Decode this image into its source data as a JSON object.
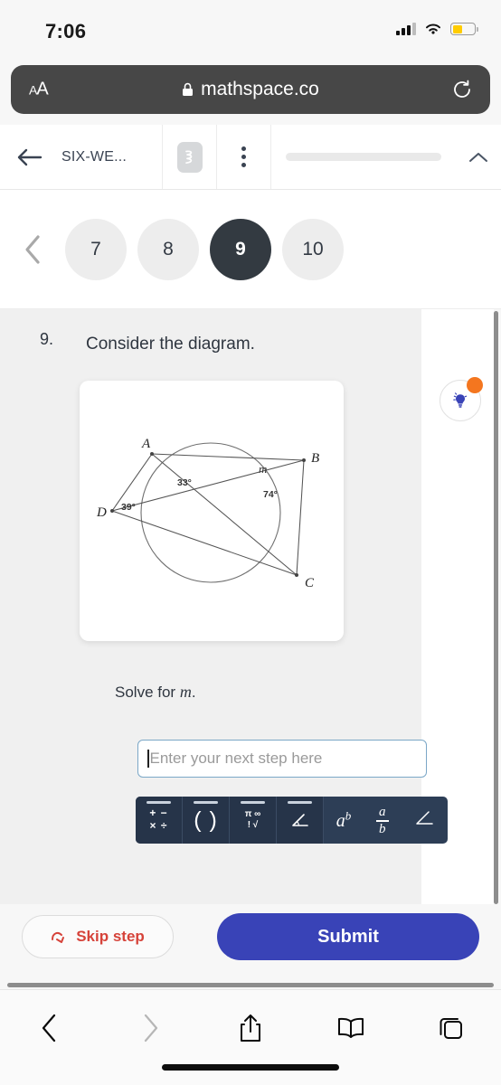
{
  "status_bar": {
    "time": "7:06",
    "signal_icon": "signal-bars-icon",
    "wifi_icon": "wifi-icon",
    "battery_icon": "battery-icon",
    "battery_color": "#ffcc00"
  },
  "browser": {
    "text_size_label": "AA",
    "lock_icon": "lock-icon",
    "url": "mathspace.co",
    "reload_icon": "reload-icon",
    "bottom_toolbar": {
      "back_icon": "chevron-left-icon",
      "forward_icon": "chevron-right-icon",
      "share_icon": "share-icon",
      "bookmarks_icon": "book-icon",
      "tabs_icon": "tabs-icon"
    }
  },
  "app_nav": {
    "back_icon": "arrow-left-icon",
    "title": "SIX-WE...",
    "logo_icon": "mathspace-logo-icon",
    "menu_icon": "more-vertical-icon",
    "collapse_icon": "chevron-up-icon"
  },
  "question_pills": {
    "prev_icon": "chevron-left-icon",
    "items": [
      {
        "label": "7",
        "active": false
      },
      {
        "label": "8",
        "active": false
      },
      {
        "label": "9",
        "active": true
      },
      {
        "label": "10",
        "active": false
      }
    ]
  },
  "question": {
    "number": "9.",
    "prompt": "Consider the diagram.",
    "instruction_prefix": "Solve for ",
    "instruction_variable": "m",
    "instruction_suffix": "."
  },
  "diagram": {
    "type": "circle-with-inscribed-quadrilateral",
    "vertex_labels": [
      "A",
      "B",
      "C",
      "D"
    ],
    "angle_labels": [
      {
        "text": "33°",
        "at_vertex": "A"
      },
      {
        "text": "39°",
        "at_vertex": "D"
      },
      {
        "text": "m",
        "at_vertex": "B"
      },
      {
        "text": "74°",
        "at_vertex": "B"
      }
    ]
  },
  "answer_input": {
    "placeholder": "Enter your next step here",
    "value": "",
    "border_color": "#7ba7c7"
  },
  "math_keyboard": {
    "tabs": [
      {
        "name": "operators-tab",
        "icon": "plus-minus-times-divide-icon",
        "line1": "+ −",
        "line2": "× ÷"
      },
      {
        "name": "parentheses-tab",
        "icon": "parentheses-icon",
        "glyph": "( )"
      },
      {
        "name": "symbols-tab",
        "icon": "pi-infinity-factorial-root-icon",
        "line1": "π ∞",
        "line2": "! √"
      },
      {
        "name": "geometry-tab",
        "icon": "angle-icon",
        "glyph": "∠"
      }
    ],
    "keys": [
      {
        "name": "power-key",
        "icon": "a-to-the-b-icon",
        "base": "a",
        "exponent": "b"
      },
      {
        "name": "fraction-key",
        "icon": "fraction-icon",
        "numerator": "a",
        "denominator": "b"
      },
      {
        "name": "angle-key",
        "icon": "angle-icon",
        "glyph": "∠"
      }
    ]
  },
  "hint_button": {
    "icon": "lightbulb-icon",
    "badge_color": "#f4761f",
    "bulb_color": "#3943b7"
  },
  "actions": {
    "skip_label": "Skip step",
    "skip_icon": "skip-arrow-icon",
    "skip_color": "#d6433a",
    "submit_label": "Submit",
    "submit_color": "#3943b7"
  }
}
